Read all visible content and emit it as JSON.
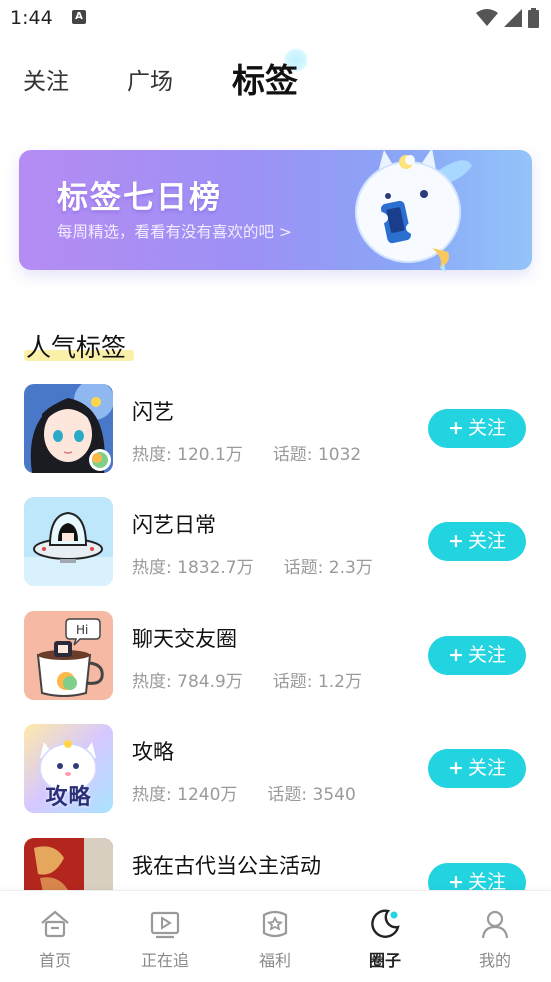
{
  "status_bar": {
    "time": "1:44",
    "notification_icon": "A"
  },
  "tabs": [
    {
      "label": "关注",
      "active": false
    },
    {
      "label": "广场",
      "active": false
    },
    {
      "label": "标签",
      "active": true
    }
  ],
  "banner": {
    "title": "标签七日榜",
    "subtitle": "每周精选，看看有没有喜欢的吧 >"
  },
  "section": {
    "title": "人气标签"
  },
  "tags": [
    {
      "name": "闪艺",
      "heat_label": "热度: 120.1万",
      "topic_label": "话题: 1032",
      "follow_label": "关注",
      "thumb": "anime-girl"
    },
    {
      "name": "闪艺日常",
      "heat_label": "热度: 1832.7万",
      "topic_label": "话题: 2.3万",
      "follow_label": "关注",
      "thumb": "ufo-pixel"
    },
    {
      "name": "聊天交友圈",
      "heat_label": "热度: 784.9万",
      "topic_label": "话题: 1.2万",
      "follow_label": "关注",
      "thumb": "cup-hi"
    },
    {
      "name": "攻略",
      "heat_label": "热度: 1240万",
      "topic_label": "话题: 3540",
      "follow_label": "关注",
      "thumb": "cat-guide",
      "thumb_text": "攻略"
    },
    {
      "name": "我在古代当公主活动",
      "heat_label": "",
      "topic_label": "",
      "follow_label": "关注",
      "thumb": "red-poster"
    }
  ],
  "bottom_nav": [
    {
      "label": "首页",
      "icon": "home-icon",
      "active": false
    },
    {
      "label": "正在追",
      "icon": "play-icon",
      "active": false
    },
    {
      "label": "福利",
      "icon": "gift-icon",
      "active": false
    },
    {
      "label": "圈子",
      "icon": "circle-icon",
      "active": true
    },
    {
      "label": "我的",
      "icon": "user-icon",
      "active": false
    }
  ],
  "colors": {
    "accent": "#22d3e0",
    "banner_start": "#b58cf4",
    "banner_end": "#93c4f8"
  }
}
